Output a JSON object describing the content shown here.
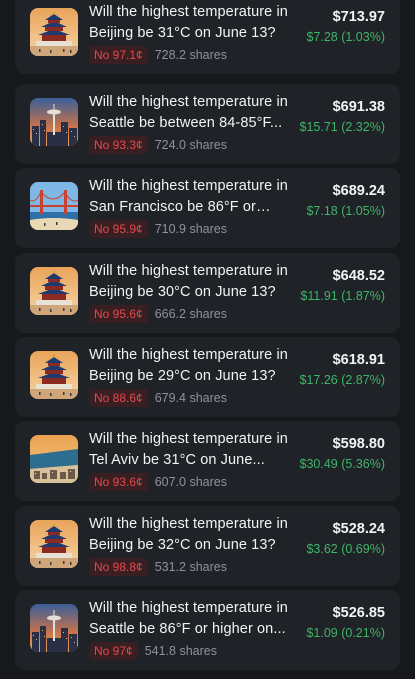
{
  "positions": [
    {
      "city_image": "beijing-temple-icon",
      "title": "Will the highest temperature in Beijing be 31°C on June 13?",
      "outcome_label": "No 97.1¢",
      "shares": "728.2 shares",
      "value": "$713.97",
      "change": "$7.28 (1.03%)"
    },
    {
      "city_image": "seattle-skyline-icon",
      "title": "Will the highest temperature in Seattle be between 84-85°F...",
      "outcome_label": "No 93.3¢",
      "shares": "724.0 shares",
      "value": "$691.38",
      "change": "$15.71 (2.32%)"
    },
    {
      "city_image": "golden-gate-bridge-icon",
      "title": "Will the highest temperature in San Francisco be 86°F or high...",
      "outcome_label": "No 95.9¢",
      "shares": "710.9 shares",
      "value": "$689.24",
      "change": "$7.18 (1.05%)"
    },
    {
      "city_image": "beijing-temple-icon",
      "title": "Will the highest temperature in Beijing be 30°C on June 13?",
      "outcome_label": "No 95.6¢",
      "shares": "666.2 shares",
      "value": "$648.52",
      "change": "$11.91 (1.87%)"
    },
    {
      "city_image": "beijing-temple-icon",
      "title": "Will the highest temperature in Beijing be 29°C on June 13?",
      "outcome_label": "No 88.6¢",
      "shares": "679.4 shares",
      "value": "$618.91",
      "change": "$17.26 (2.87%)"
    },
    {
      "city_image": "tel-aviv-coast-icon",
      "title": "Will the highest temperature in Tel Aviv be 31°C on June...",
      "outcome_label": "No 93.6¢",
      "shares": "607.0 shares",
      "value": "$598.80",
      "change": "$30.49 (5.36%)"
    },
    {
      "city_image": "beijing-temple-icon",
      "title": "Will the highest temperature in Beijing be 32°C on June 13?",
      "outcome_label": "No 98.8¢",
      "shares": "531.2 shares",
      "value": "$528.24",
      "change": "$3.62 (0.69%)"
    },
    {
      "city_image": "seattle-skyline-icon",
      "title": "Will the highest temperature in Seattle be 86°F or higher on...",
      "outcome_label": "No 97¢",
      "shares": "541.8 shares",
      "value": "$526.85",
      "change": "$1.09 (0.21%)"
    }
  ],
  "colors": {
    "background": "#16181c",
    "card": "#1f2226",
    "no_badge_text": "#e5484d",
    "no_badge_bg": "#3a1f22",
    "gain": "#3fb56a"
  }
}
